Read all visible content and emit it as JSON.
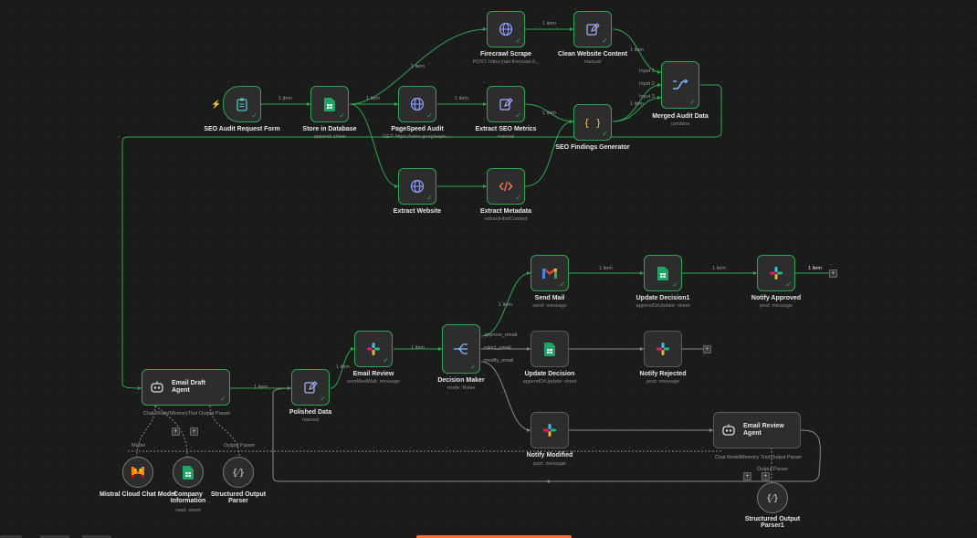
{
  "nodes": {
    "seo_form": {
      "label": "SEO Audit Request Form",
      "icon": "clipboard-icon"
    },
    "store_db": {
      "label": "Store in Database",
      "sub": "append: sheet",
      "icon": "google-sheets-icon"
    },
    "firecrawl": {
      "label": "Firecrawl Scrape",
      "sub": "POST: https://api.firecrawl.d...",
      "icon": "globe-icon"
    },
    "clean": {
      "label": "Clean Website Content",
      "sub": "manual",
      "icon": "edit-icon"
    },
    "pagespeed": {
      "label": "PageSpeed Audit",
      "sub": "GET: https://www.googleapis....",
      "icon": "globe-icon"
    },
    "extract_seo": {
      "label": "Extract SEO Metrics",
      "sub": "manual",
      "icon": "edit-icon"
    },
    "extract_web": {
      "label": "Extract Website",
      "icon": "globe-icon"
    },
    "extract_meta": {
      "label": "Extract Metadata",
      "sub": "extractHtmlContent",
      "icon": "code-icon"
    },
    "findings": {
      "label": "SEO Findings Generator",
      "icon": "braces-icon"
    },
    "merged": {
      "label": "Merged Audit Data",
      "sub": "combine",
      "icon": "merge-icon"
    },
    "email_draft": {
      "label": "Email Draft Agent",
      "icon": "robot-icon"
    },
    "polished": {
      "label": "Polished Data",
      "sub": "manual",
      "icon": "edit-icon"
    },
    "email_review": {
      "label": "Email Review",
      "sub": "sendAndWait: message",
      "icon": "slack-icon"
    },
    "decision": {
      "label": "Decision Maker",
      "sub": "mode: Rules",
      "icon": "switch-icon"
    },
    "send_mail": {
      "label": "Send Mail",
      "sub": "send: message",
      "icon": "gmail-icon"
    },
    "update_decision1": {
      "label": "Update Decision1",
      "sub": "appendOrUpdate: sheet",
      "icon": "google-sheets-icon"
    },
    "notify_approved": {
      "label": "Notify Approved",
      "sub": "post: message",
      "icon": "slack-icon"
    },
    "update_decision": {
      "label": "Update Decision",
      "sub": "appendOrUpdate: sheet",
      "icon": "google-sheets-icon"
    },
    "notify_rejected": {
      "label": "Notify Rejected",
      "sub": "post: message",
      "icon": "slack-icon"
    },
    "notify_modified": {
      "label": "Notify Modified",
      "sub": "post: message",
      "icon": "slack-icon"
    },
    "email_review_agent": {
      "label": "Email Review Agent",
      "icon": "robot-icon"
    },
    "mistral": {
      "label": "Mistral Cloud Chat Model",
      "icon": "mistral-icon"
    },
    "company_info": {
      "label": "Company Information",
      "sub": "read: sheet",
      "icon": "google-sheets-icon"
    },
    "struct_parser": {
      "label": "Structured Output Parser",
      "icon": "braces-icon"
    },
    "struct_parser1": {
      "label": "Structured Output Parser1",
      "icon": "braces-icon"
    }
  },
  "edges": {
    "item1": "1 item"
  },
  "merge_inputs": [
    "Input 1",
    "Input 2",
    "Input 3"
  ],
  "decision_outputs": [
    "approve_email",
    "reject_email",
    "modify_email"
  ],
  "agent_ports": {
    "chat_model": "Chat Model",
    "memory": "Memory",
    "tool": "Tool",
    "output_parser": "Output Parser",
    "model": "Model"
  },
  "colors": {
    "background": "#1b1b1b",
    "success": "#2aa84f",
    "node": "#2d2d2d",
    "wire": "#2aa84f",
    "inactive_wire": "#8a8a8a",
    "trigger": "#ff6d3a"
  }
}
